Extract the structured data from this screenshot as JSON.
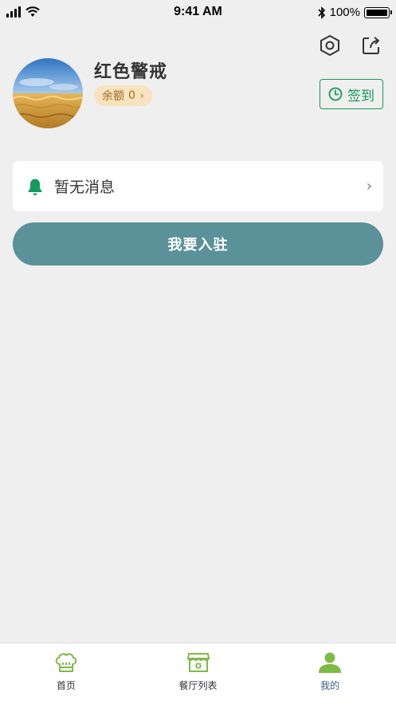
{
  "status_bar": {
    "time": "9:41 AM",
    "battery": "100%",
    "icons": [
      "signal-icon",
      "wifi-icon",
      "bluetooth-icon",
      "battery-icon"
    ]
  },
  "header": {
    "icons": [
      "settings-hexagon-icon",
      "share-icon"
    ]
  },
  "profile": {
    "name": "红色警戒",
    "balance_label": "余额",
    "balance_value": "0",
    "balance_chevron": "›",
    "avatar": "wheat-field-avatar"
  },
  "checkin": {
    "label": "签到",
    "icon": "clock-icon"
  },
  "message": {
    "text": "暂无消息",
    "icon": "bell-icon",
    "chevron": "›"
  },
  "join_button": {
    "label": "我要入驻"
  },
  "tabbar": {
    "tabs": [
      {
        "label": "首页",
        "icon": "chef-hat-icon"
      },
      {
        "label": "餐厅列表",
        "icon": "storefront-icon"
      },
      {
        "label": "我的",
        "icon": "user-icon",
        "active": true
      }
    ]
  },
  "colors": {
    "background": "#efefef",
    "accent_green": "#16995c",
    "join_button": "#5b9199",
    "balance_bg": "#f8e3bf",
    "balance_text": "#a06a1c",
    "tab_active": "#3a5f8f",
    "tab_icon_green": "#7cbb45"
  }
}
